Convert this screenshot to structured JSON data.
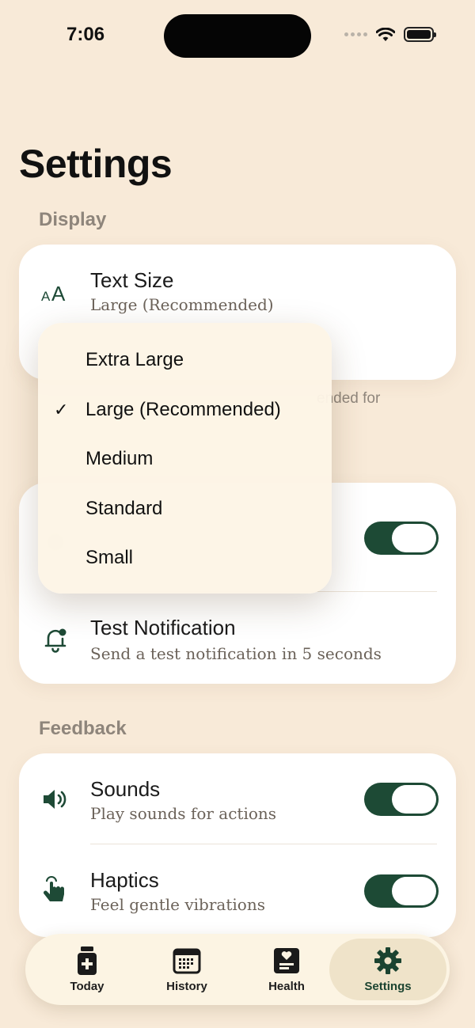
{
  "status_bar": {
    "time": "7:06"
  },
  "page": {
    "title": "Settings"
  },
  "sections": {
    "display": {
      "header": "Display",
      "text_size": {
        "title": "Text Size",
        "subtitle": "Large (Recommended)"
      },
      "footer_note_visible_fragment": "ended for"
    },
    "notifications": {
      "test": {
        "title": "Test Notification",
        "subtitle": "Send a test notification in 5 seconds"
      },
      "toggle_on": true
    },
    "feedback": {
      "header": "Feedback",
      "sounds": {
        "title": "Sounds",
        "subtitle": "Play sounds for actions",
        "enabled": true
      },
      "haptics": {
        "title": "Haptics",
        "subtitle": "Feel gentle vibrations",
        "enabled": true
      }
    }
  },
  "text_size_menu": {
    "options": [
      {
        "label": "Extra Large",
        "selected": false
      },
      {
        "label": "Large (Recommended)",
        "selected": true
      },
      {
        "label": "Medium",
        "selected": false
      },
      {
        "label": "Standard",
        "selected": false
      },
      {
        "label": "Small",
        "selected": false
      }
    ],
    "check_glyph": "✓"
  },
  "tab_bar": {
    "tabs": [
      {
        "label": "Today",
        "icon": "medicine-bottle-icon",
        "active": false
      },
      {
        "label": "History",
        "icon": "calendar-icon",
        "active": false
      },
      {
        "label": "Health",
        "icon": "health-record-icon",
        "active": false
      },
      {
        "label": "Settings",
        "icon": "gear-icon",
        "active": true
      }
    ]
  },
  "colors": {
    "background": "#f8ead8",
    "accent": "#1d4a35",
    "card": "#ffffff",
    "menu": "#fdf5e6"
  }
}
